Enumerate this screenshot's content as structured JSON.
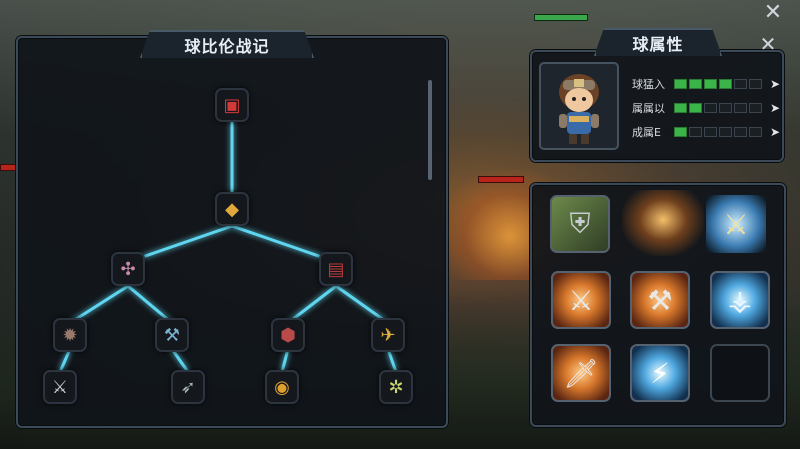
{
  "skill_tree": {
    "title": "球比伦战记",
    "close_label": "✕"
  },
  "attributes": {
    "title": "球属性",
    "close_label": "✕",
    "stats": [
      {
        "label": "球猛入",
        "level": 4,
        "max": 6
      },
      {
        "label": "属属以",
        "level": 2,
        "max": 6
      },
      {
        "label": "成属E",
        "level": 1,
        "max": 6
      }
    ],
    "upgrade_glyph": "➤"
  },
  "colors": {
    "tree_link": "#5fd6f0",
    "stat_on": "#3bb44a"
  }
}
